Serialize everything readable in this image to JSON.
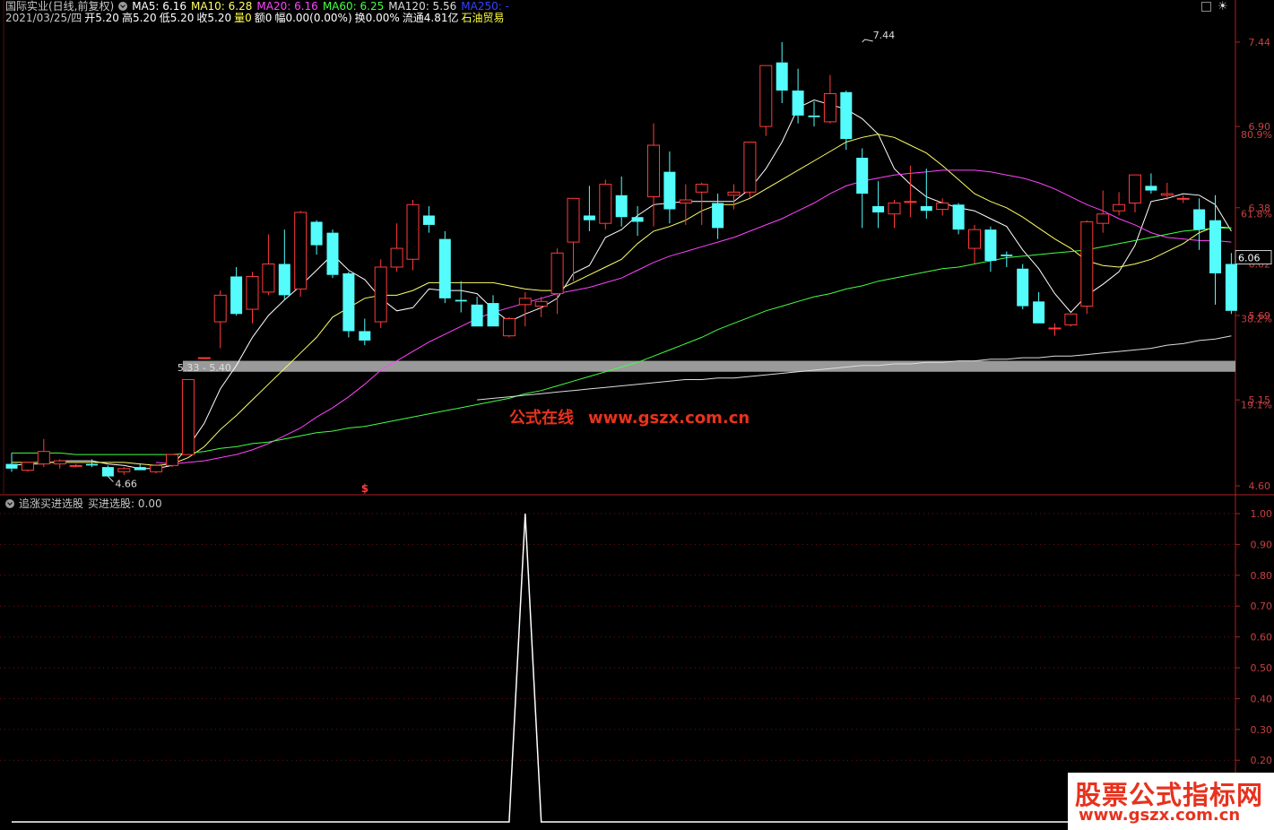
{
  "header": {
    "stock": "国际实业(日线,前复权)",
    "ma": [
      {
        "label": "MA5: 6.16",
        "color": "#ffffff"
      },
      {
        "label": "MA10: 6.28",
        "color": "#ffff66"
      },
      {
        "label": "MA20: 6.16",
        "color": "#ff44ff"
      },
      {
        "label": "MA60: 6.25",
        "color": "#44ff44"
      },
      {
        "label": "MA120: 5.56",
        "color": "#dddddd"
      },
      {
        "label": "MA250: -",
        "color": "#3344ff"
      }
    ],
    "info": [
      {
        "label": "2021/03/25/四",
        "color": "#c8c8c8"
      },
      {
        "label": "开5.20",
        "color": "#ffffff"
      },
      {
        "label": "高5.20",
        "color": "#ffffff"
      },
      {
        "label": "低5.20",
        "color": "#ffffff"
      },
      {
        "label": "收5.20",
        "color": "#ffffff"
      },
      {
        "label": "量0",
        "color": "#ffff44"
      },
      {
        "label": "额0",
        "color": "#ffffff"
      },
      {
        "label": "幅0.00(0.00%)",
        "color": "#ffffff"
      },
      {
        "label": "换0.00%",
        "color": "#ffffff"
      },
      {
        "label": "流通4.81亿",
        "color": "#ffffff"
      },
      {
        "label": "石油贸易",
        "color": "#ffff44"
      }
    ]
  },
  "indicator": {
    "name": "追涨买进选股",
    "value_label": "买进选股: 0.00"
  },
  "watermark": {
    "center": "公式在线",
    "center_url": "www.gszx.com.cn",
    "badge": "股票公式指标网",
    "badge_url": "www.gszx.com.cn"
  },
  "colors": {
    "up": "#ff3b3b",
    "down": "#54fcfc",
    "axis": "#b02020",
    "band": "#9a9a9a"
  },
  "chart_data": [
    {
      "type": "candlestick",
      "ylim": [
        4.6,
        7.44
      ],
      "y_axis_ticks": [
        "7.44",
        "6.90",
        "6.38",
        "6.02",
        "5.69",
        "5.15",
        "4.60"
      ],
      "percent_ticks": [
        {
          "label": "80.9%",
          "value": 6.85
        },
        {
          "label": "61.8%",
          "value": 6.34
        },
        {
          "label": "38.2%",
          "value": 5.67
        },
        {
          "label": "19.1%",
          "value": 5.12
        }
      ],
      "current_price_label": "6.06",
      "current_price": 6.06,
      "annotations": [
        {
          "text": "7.44",
          "x": 53,
          "y": 7.44
        },
        {
          "text": "4.66",
          "x": 6,
          "y": 4.66
        },
        {
          "text": "5.33 - 5.40",
          "x": 11,
          "y": 5.37
        },
        {
          "text": "$",
          "x": 22,
          "y": 4.6
        }
      ],
      "support_band": {
        "from": 5.33,
        "to": 5.4,
        "x_start": 11,
        "color": "#9a9a9a"
      },
      "candles": [
        {
          "o": 4.74,
          "h": 4.81,
          "l": 4.69,
          "c": 4.71
        },
        {
          "o": 4.7,
          "h": 4.75,
          "l": 4.69,
          "c": 4.75
        },
        {
          "o": 4.74,
          "h": 4.9,
          "l": 4.72,
          "c": 4.82
        },
        {
          "o": 4.74,
          "h": 4.77,
          "l": 4.71,
          "c": 4.76
        },
        {
          "o": 4.73,
          "h": 4.74,
          "l": 4.72,
          "c": 4.73
        },
        {
          "o": 4.74,
          "h": 4.77,
          "l": 4.72,
          "c": 4.73
        },
        {
          "o": 4.72,
          "h": 4.73,
          "l": 4.66,
          "c": 4.66
        },
        {
          "o": 4.69,
          "h": 4.72,
          "l": 4.67,
          "c": 4.71
        },
        {
          "o": 4.72,
          "h": 4.74,
          "l": 4.7,
          "c": 4.7
        },
        {
          "o": 4.69,
          "h": 4.74,
          "l": 4.68,
          "c": 4.73
        },
        {
          "o": 4.73,
          "h": 4.8,
          "l": 4.72,
          "c": 4.8
        },
        {
          "o": 4.8,
          "h": 5.28,
          "l": 4.8,
          "c": 5.28
        },
        {
          "o": 5.42,
          "h": 5.42,
          "l": 5.42,
          "c": 5.42
        },
        {
          "o": 5.65,
          "h": 5.85,
          "l": 5.48,
          "c": 5.82
        },
        {
          "o": 5.94,
          "h": 6.0,
          "l": 5.69,
          "c": 5.7
        },
        {
          "o": 5.73,
          "h": 5.97,
          "l": 5.64,
          "c": 5.94
        },
        {
          "o": 5.84,
          "h": 6.21,
          "l": 5.82,
          "c": 6.02
        },
        {
          "o": 6.02,
          "h": 6.24,
          "l": 5.79,
          "c": 5.82
        },
        {
          "o": 5.86,
          "h": 6.36,
          "l": 5.81,
          "c": 6.35
        },
        {
          "o": 6.29,
          "h": 6.3,
          "l": 6.08,
          "c": 6.14
        },
        {
          "o": 6.22,
          "h": 6.24,
          "l": 5.93,
          "c": 5.95
        },
        {
          "o": 5.96,
          "h": 5.97,
          "l": 5.55,
          "c": 5.59
        },
        {
          "o": 5.59,
          "h": 5.67,
          "l": 5.5,
          "c": 5.53
        },
        {
          "o": 5.65,
          "h": 6.05,
          "l": 5.61,
          "c": 6.0
        },
        {
          "o": 6.0,
          "h": 6.28,
          "l": 5.97,
          "c": 6.12
        },
        {
          "o": 6.05,
          "h": 6.43,
          "l": 5.98,
          "c": 6.4
        },
        {
          "o": 6.33,
          "h": 6.39,
          "l": 6.22,
          "c": 6.27
        },
        {
          "o": 6.18,
          "h": 6.23,
          "l": 5.77,
          "c": 5.8
        },
        {
          "o": 5.79,
          "h": 5.91,
          "l": 5.71,
          "c": 5.78
        },
        {
          "o": 5.76,
          "h": 5.81,
          "l": 5.62,
          "c": 5.62
        },
        {
          "o": 5.77,
          "h": 5.82,
          "l": 5.62,
          "c": 5.62
        },
        {
          "o": 5.56,
          "h": 5.68,
          "l": 5.55,
          "c": 5.67
        },
        {
          "o": 5.76,
          "h": 5.84,
          "l": 5.62,
          "c": 5.8
        },
        {
          "o": 5.75,
          "h": 5.81,
          "l": 5.68,
          "c": 5.78
        },
        {
          "o": 5.83,
          "h": 6.12,
          "l": 5.7,
          "c": 6.09
        },
        {
          "o": 6.16,
          "h": 6.44,
          "l": 5.91,
          "c": 6.44
        },
        {
          "o": 6.33,
          "h": 6.52,
          "l": 6.23,
          "c": 6.3
        },
        {
          "o": 6.28,
          "h": 6.56,
          "l": 6.24,
          "c": 6.53
        },
        {
          "o": 6.46,
          "h": 6.58,
          "l": 6.26,
          "c": 6.32
        },
        {
          "o": 6.32,
          "h": 6.39,
          "l": 6.2,
          "c": 6.29
        },
        {
          "o": 6.45,
          "h": 6.92,
          "l": 6.26,
          "c": 6.78
        },
        {
          "o": 6.61,
          "h": 6.74,
          "l": 6.28,
          "c": 6.37
        },
        {
          "o": 6.41,
          "h": 6.53,
          "l": 6.27,
          "c": 6.43
        },
        {
          "o": 6.48,
          "h": 6.54,
          "l": 6.27,
          "c": 6.53
        },
        {
          "o": 6.41,
          "h": 6.47,
          "l": 6.18,
          "c": 6.25
        },
        {
          "o": 6.46,
          "h": 6.53,
          "l": 6.37,
          "c": 6.48
        },
        {
          "o": 6.48,
          "h": 6.8,
          "l": 6.44,
          "c": 6.8
        },
        {
          "o": 6.9,
          "h": 7.29,
          "l": 6.84,
          "c": 7.29
        },
        {
          "o": 7.31,
          "h": 7.44,
          "l": 7.05,
          "c": 7.13
        },
        {
          "o": 7.13,
          "h": 7.27,
          "l": 6.92,
          "c": 6.97
        },
        {
          "o": 6.97,
          "h": 7.06,
          "l": 6.9,
          "c": 6.96
        },
        {
          "o": 6.93,
          "h": 7.23,
          "l": 6.92,
          "c": 7.11
        },
        {
          "o": 7.12,
          "h": 7.13,
          "l": 6.75,
          "c": 6.82
        },
        {
          "o": 6.7,
          "h": 6.76,
          "l": 6.25,
          "c": 6.47
        },
        {
          "o": 6.39,
          "h": 6.55,
          "l": 6.25,
          "c": 6.35
        },
        {
          "o": 6.34,
          "h": 6.43,
          "l": 6.25,
          "c": 6.41
        },
        {
          "o": 6.42,
          "h": 6.65,
          "l": 6.32,
          "c": 6.42
        },
        {
          "o": 6.39,
          "h": 6.63,
          "l": 6.31,
          "c": 6.36
        },
        {
          "o": 6.37,
          "h": 6.44,
          "l": 6.33,
          "c": 6.41
        },
        {
          "o": 6.4,
          "h": 6.41,
          "l": 6.21,
          "c": 6.24
        },
        {
          "o": 6.12,
          "h": 6.27,
          "l": 6.02,
          "c": 6.24
        },
        {
          "o": 6.24,
          "h": 6.26,
          "l": 5.97,
          "c": 6.04
        },
        {
          "o": 6.08,
          "h": 6.1,
          "l": 6.0,
          "c": 6.07
        },
        {
          "o": 5.99,
          "h": 6.02,
          "l": 5.73,
          "c": 5.75
        },
        {
          "o": 5.78,
          "h": 5.84,
          "l": 5.64,
          "c": 5.64
        },
        {
          "o": 5.61,
          "h": 5.64,
          "l": 5.56,
          "c": 5.61
        },
        {
          "o": 5.63,
          "h": 5.7,
          "l": 5.62,
          "c": 5.7
        },
        {
          "o": 5.75,
          "h": 6.3,
          "l": 5.7,
          "c": 6.29
        },
        {
          "o": 6.28,
          "h": 6.49,
          "l": 6.22,
          "c": 6.34
        },
        {
          "o": 6.36,
          "h": 6.48,
          "l": 6.33,
          "c": 6.4
        },
        {
          "o": 6.41,
          "h": 6.58,
          "l": 6.35,
          "c": 6.59
        },
        {
          "o": 6.52,
          "h": 6.6,
          "l": 6.47,
          "c": 6.49
        },
        {
          "o": 6.46,
          "h": 6.54,
          "l": 6.43,
          "c": 6.47
        },
        {
          "o": 6.44,
          "h": 6.46,
          "l": 6.41,
          "c": 6.44
        },
        {
          "o": 6.37,
          "h": 6.44,
          "l": 6.11,
          "c": 6.24
        },
        {
          "o": 6.3,
          "h": 6.46,
          "l": 5.76,
          "c": 5.96
        },
        {
          "o": 6.02,
          "h": 6.09,
          "l": 5.7,
          "c": 5.72
        }
      ],
      "ma_lines": [
        {
          "name": "MA5",
          "color": "#ffffff",
          "values": [
            4.73,
            4.74,
            4.74,
            4.76,
            4.76,
            4.76,
            4.74,
            4.73,
            4.71,
            4.71,
            4.73,
            4.85,
            5.0,
            5.22,
            5.37,
            5.55,
            5.69,
            5.79,
            5.88,
            5.98,
            6.08,
            5.98,
            5.92,
            5.8,
            5.72,
            5.74,
            5.86,
            5.85,
            5.85,
            5.83,
            5.73,
            5.65,
            5.7,
            5.74,
            5.8,
            5.96,
            6.01,
            6.19,
            6.24,
            6.33,
            6.4,
            6.41,
            6.42,
            6.42,
            6.42,
            6.42,
            6.5,
            6.63,
            6.8,
            7.02,
            7.07,
            7.04,
            7.01,
            6.95,
            6.85,
            6.63,
            6.53,
            6.45,
            6.41,
            6.38,
            6.36,
            6.31,
            6.26,
            6.11,
            5.99,
            5.83,
            5.71,
            5.82,
            5.89,
            5.97,
            6.14,
            6.42,
            6.44,
            6.47,
            6.46,
            6.4,
            6.23
          ]
        },
        {
          "name": "MA10",
          "color": "#ffff66",
          "values": [
            4.75,
            4.75,
            4.75,
            4.75,
            4.75,
            4.75,
            4.75,
            4.75,
            4.74,
            4.73,
            4.74,
            4.78,
            4.85,
            4.96,
            5.05,
            5.15,
            5.25,
            5.35,
            5.45,
            5.55,
            5.68,
            5.74,
            5.8,
            5.82,
            5.82,
            5.85,
            5.9,
            5.9,
            5.9,
            5.9,
            5.9,
            5.88,
            5.86,
            5.85,
            5.85,
            5.9,
            5.95,
            6.0,
            6.05,
            6.15,
            6.23,
            6.26,
            6.3,
            6.36,
            6.4,
            6.4,
            6.44,
            6.5,
            6.56,
            6.62,
            6.68,
            6.74,
            6.8,
            6.83,
            6.85,
            6.83,
            6.78,
            6.73,
            6.65,
            6.56,
            6.47,
            6.42,
            6.38,
            6.32,
            6.25,
            6.18,
            6.12,
            6.04,
            6.01,
            6.0,
            6.02,
            6.05,
            6.1,
            6.15,
            6.22,
            6.26,
            6.25
          ]
        },
        {
          "name": "MA20",
          "color": "#ff44ff",
          "values": [
            null,
            null,
            null,
            null,
            null,
            null,
            null,
            null,
            null,
            4.75,
            4.74,
            4.75,
            4.76,
            4.78,
            4.8,
            4.83,
            4.87,
            4.92,
            4.97,
            5.04,
            5.1,
            5.17,
            5.25,
            5.34,
            5.4,
            5.46,
            5.52,
            5.57,
            5.62,
            5.67,
            5.71,
            5.74,
            5.77,
            5.8,
            5.83,
            5.85,
            5.87,
            5.9,
            5.93,
            5.98,
            6.03,
            6.07,
            6.1,
            6.13,
            6.16,
            6.19,
            6.23,
            6.27,
            6.31,
            6.36,
            6.41,
            6.47,
            6.52,
            6.55,
            6.57,
            6.59,
            6.6,
            6.61,
            6.62,
            6.62,
            6.62,
            6.61,
            6.59,
            6.57,
            6.54,
            6.5,
            6.45,
            6.4,
            6.36,
            6.31,
            6.27,
            6.22,
            6.19,
            6.18,
            6.17,
            6.17,
            6.16
          ]
        },
        {
          "name": "MA60",
          "color": "#44ff44",
          "values": [
            4.81,
            4.81,
            4.81,
            4.81,
            4.8,
            4.8,
            4.8,
            4.8,
            4.8,
            4.8,
            4.8,
            4.81,
            4.82,
            4.84,
            4.85,
            4.87,
            4.88,
            4.9,
            4.92,
            4.94,
            4.95,
            4.97,
            4.98,
            5.0,
            5.02,
            5.04,
            5.06,
            5.08,
            5.1,
            5.12,
            5.14,
            5.16,
            5.19,
            5.21,
            5.24,
            5.27,
            5.3,
            5.33,
            5.36,
            5.39,
            5.43,
            5.47,
            5.51,
            5.55,
            5.6,
            5.64,
            5.68,
            5.72,
            5.75,
            5.78,
            5.81,
            5.83,
            5.86,
            5.88,
            5.91,
            5.93,
            5.95,
            5.97,
            5.99,
            6.0,
            6.02,
            6.04,
            6.06,
            6.07,
            6.08,
            6.09,
            6.1,
            6.11,
            6.13,
            6.15,
            6.17,
            6.19,
            6.21,
            6.23,
            6.24,
            6.25,
            6.25
          ]
        },
        {
          "name": "MA120",
          "color": "#dddddd",
          "values": [
            null,
            null,
            null,
            null,
            null,
            null,
            null,
            null,
            null,
            null,
            null,
            null,
            null,
            null,
            null,
            null,
            null,
            null,
            null,
            null,
            null,
            null,
            null,
            null,
            null,
            null,
            null,
            null,
            null,
            5.15,
            5.16,
            5.17,
            5.18,
            5.19,
            5.2,
            5.21,
            5.22,
            5.23,
            5.24,
            5.25,
            5.26,
            5.27,
            5.28,
            5.28,
            5.29,
            5.29,
            5.3,
            5.31,
            5.32,
            5.33,
            5.34,
            5.35,
            5.36,
            5.37,
            5.37,
            5.38,
            5.38,
            5.39,
            5.39,
            5.4,
            5.4,
            5.41,
            5.41,
            5.42,
            5.42,
            5.43,
            5.43,
            5.44,
            5.45,
            5.46,
            5.47,
            5.48,
            5.5,
            5.51,
            5.53,
            5.54,
            5.56
          ]
        }
      ]
    },
    {
      "type": "line",
      "title": "追涨买进选股",
      "ylim": [
        0,
        1
      ],
      "y_axis_ticks": [
        "1.00",
        "0.90",
        "0.80",
        "0.70",
        "0.60",
        "0.50",
        "0.40",
        "0.30",
        "0.20"
      ],
      "series": [
        {
          "name": "买进选股",
          "color": "#ffffff",
          "values": [
            0,
            0,
            0,
            0,
            0,
            0,
            0,
            0,
            0,
            0,
            0,
            0,
            0,
            0,
            0,
            0,
            0,
            0,
            0,
            0,
            0,
            0,
            0,
            0,
            0,
            0,
            0,
            0,
            0,
            0,
            0,
            0,
            1,
            0,
            0,
            0,
            0,
            0,
            0,
            0,
            0,
            0,
            0,
            0,
            0,
            0,
            0,
            0,
            0,
            0,
            0,
            0,
            0,
            0,
            0,
            0,
            0,
            0,
            0,
            0,
            0,
            0,
            0,
            0,
            0,
            0,
            0,
            0,
            0,
            0,
            0,
            0,
            0,
            0,
            0,
            0,
            0
          ]
        }
      ]
    }
  ]
}
